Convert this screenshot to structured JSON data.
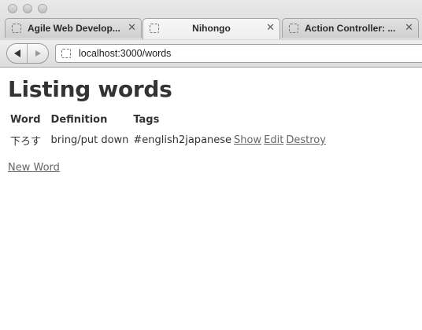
{
  "browser": {
    "tabs": [
      {
        "title": "Agile Web Develop...",
        "close": "✕",
        "active": false
      },
      {
        "title": "Nihongo",
        "close": "✕",
        "active": true
      },
      {
        "title": "Action Controller: ...",
        "close": "✕",
        "active": false
      }
    ],
    "url": "localhost:3000/words"
  },
  "page": {
    "title": "Listing words",
    "columns": [
      "Word",
      "Definition",
      "Tags"
    ],
    "rows": [
      {
        "word": "下ろす",
        "definition": "bring/put down",
        "tags": "#english2japanese",
        "show": "Show",
        "edit": "Edit",
        "destroy": "Destroy"
      }
    ],
    "new_link": "New Word"
  }
}
